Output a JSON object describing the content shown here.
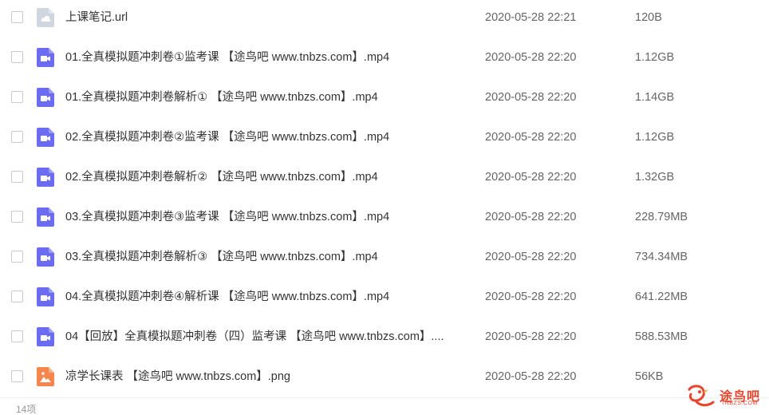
{
  "colors": {
    "url_icon": "#cfd6e0",
    "video_icon": "#6b6cf1",
    "image_icon": "#f6864b",
    "watermark": "#e8452c"
  },
  "files": [
    {
      "name": "上课笔记.url",
      "date": "2020-05-28 22:21",
      "size": "120B",
      "icon": "url-file-icon"
    },
    {
      "name": "01.全真模拟题冲刺卷①监考课 【途鸟吧 www.tnbzs.com】.mp4",
      "date": "2020-05-28 22:20",
      "size": "1.12GB",
      "icon": "video-file-icon"
    },
    {
      "name": "01.全真模拟题冲刺卷解析① 【途鸟吧 www.tnbzs.com】.mp4",
      "date": "2020-05-28 22:20",
      "size": "1.14GB",
      "icon": "video-file-icon"
    },
    {
      "name": "02.全真模拟题冲刺卷②监考课 【途鸟吧 www.tnbzs.com】.mp4",
      "date": "2020-05-28 22:20",
      "size": "1.12GB",
      "icon": "video-file-icon"
    },
    {
      "name": "02.全真模拟题冲刺卷解析② 【途鸟吧 www.tnbzs.com】.mp4",
      "date": "2020-05-28 22:20",
      "size": "1.32GB",
      "icon": "video-file-icon"
    },
    {
      "name": "03.全真模拟题冲刺卷③监考课 【途鸟吧 www.tnbzs.com】.mp4",
      "date": "2020-05-28 22:20",
      "size": "228.79MB",
      "icon": "video-file-icon"
    },
    {
      "name": "03.全真模拟题冲刺卷解析③ 【途鸟吧 www.tnbzs.com】.mp4",
      "date": "2020-05-28 22:20",
      "size": "734.34MB",
      "icon": "video-file-icon"
    },
    {
      "name": "04.全真模拟题冲刺卷④解析课 【途鸟吧 www.tnbzs.com】.mp4",
      "date": "2020-05-28 22:20",
      "size": "641.22MB",
      "icon": "video-file-icon"
    },
    {
      "name": "04【回放】全真模拟题冲刺卷（四）监考课 【途鸟吧 www.tnbzs.com】....",
      "date": "2020-05-28 22:20",
      "size": "588.53MB",
      "icon": "video-file-icon"
    },
    {
      "name": "凉学长课表 【途鸟吧 www.tnbzs.com】.png",
      "date": "2020-05-28 22:20",
      "size": "56KB",
      "icon": "image-file-icon"
    }
  ],
  "footer": {
    "count": "14项"
  },
  "watermark": {
    "text": "途鸟吧",
    "subtext": "TNBZS.COM"
  }
}
